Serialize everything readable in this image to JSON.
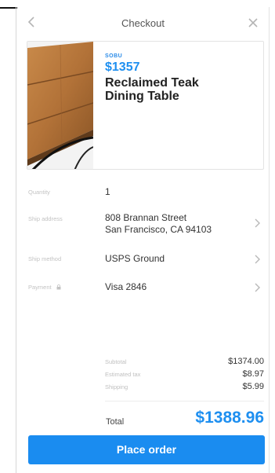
{
  "header": {
    "title": "Checkout",
    "back_icon": "chevron-left-icon",
    "close_icon": "close-icon"
  },
  "product": {
    "brand": "SOBU",
    "price": "$1357",
    "name_line1": "Reclaimed Teak",
    "name_line2": "Dining Table"
  },
  "details": {
    "quantity_label": "Quantity",
    "quantity_value": "1",
    "ship_address_label": "Ship address",
    "ship_address_line1": "808 Brannan Street",
    "ship_address_line2": "San Francisco, CA 94103",
    "ship_method_label": "Ship method",
    "ship_method_value": "USPS Ground",
    "payment_label": "Payment",
    "payment_value": "Visa 2846"
  },
  "summary": {
    "subtotal_label": "Subtotal",
    "subtotal_value": "$1374.00",
    "tax_label": "Estimated tax",
    "tax_value": "$8.97",
    "shipping_label": "Shipping",
    "shipping_value": "$5.99",
    "total_label": "Total",
    "total_value": "$1388.96"
  },
  "actions": {
    "place_order_label": "Place order"
  },
  "colors": {
    "accent": "#1a8cf0",
    "price_blue": "#1e8ff0"
  }
}
